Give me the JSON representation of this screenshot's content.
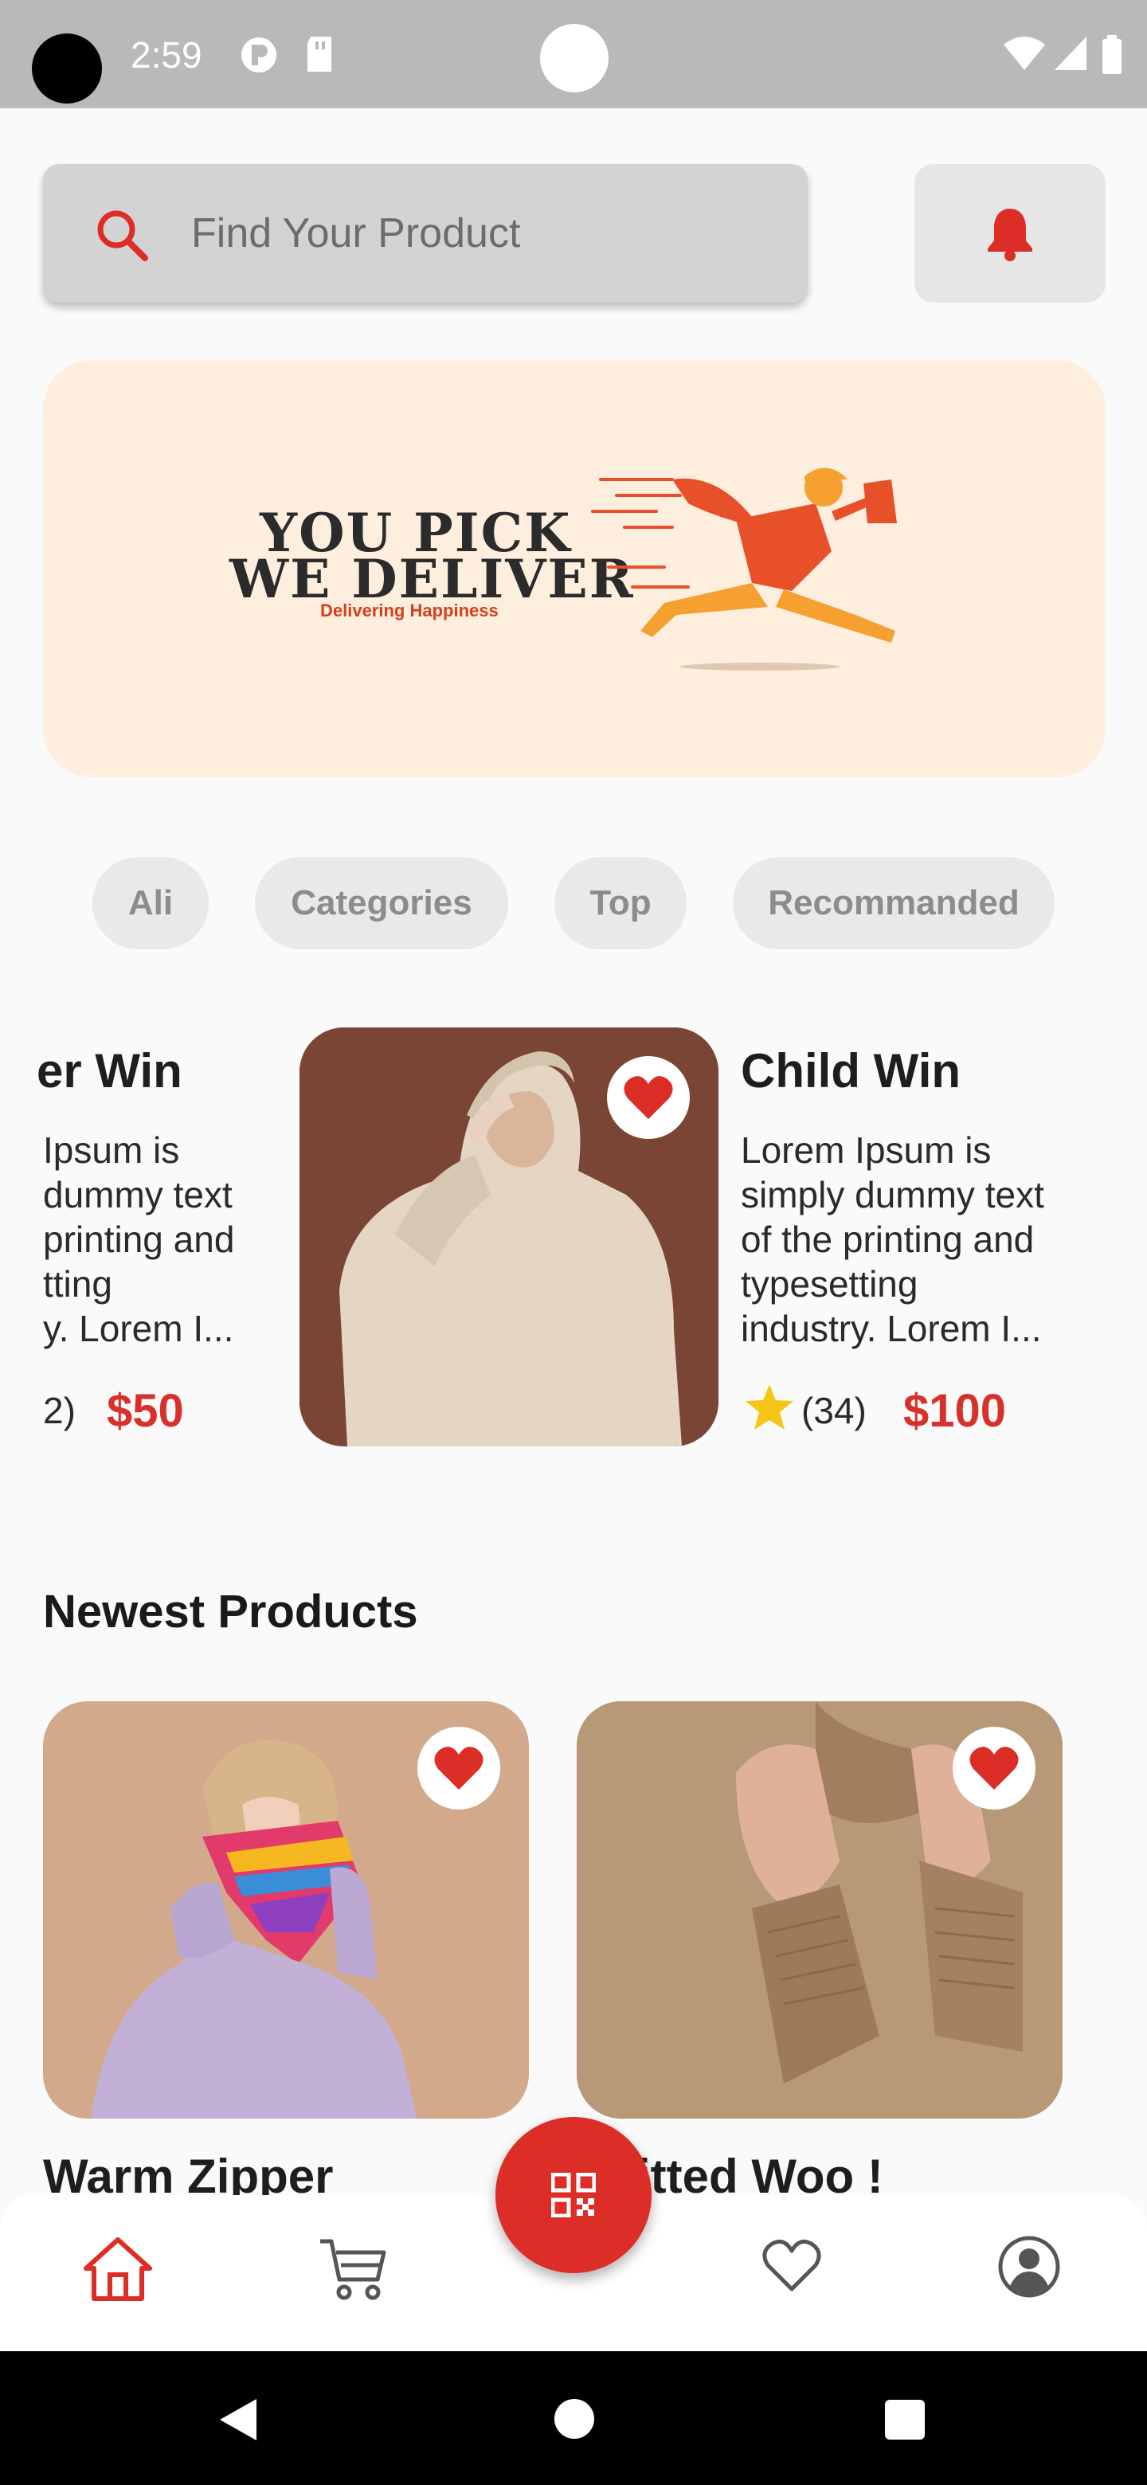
{
  "status_bar": {
    "time": "2:59"
  },
  "search": {
    "placeholder": "Find Your Product"
  },
  "banner": {
    "line1": "YOU PICK",
    "line2": "WE DELIVER",
    "tagline": "Delivering Happiness"
  },
  "tabs": [
    {
      "label": "Ali"
    },
    {
      "label": "Categories"
    },
    {
      "label": "Top"
    },
    {
      "label": "Recommanded"
    }
  ],
  "featured": [
    {
      "title": "er Win",
      "desc_lines": [
        "Ipsum is",
        "dummy text",
        "printing and",
        "tting",
        "y. Lorem I..."
      ],
      "rating": "2)",
      "price": "$50"
    },
    {
      "title": "Child Win",
      "desc_lines": [
        "Lorem Ipsum is",
        "simply dummy text",
        "of the printing and",
        "typesetting",
        "industry. Lorem I..."
      ],
      "rating": "(34)",
      "price": "$100"
    }
  ],
  "newest": {
    "section_title": "Newest Products",
    "products": [
      {
        "title": "Warm Zipper"
      },
      {
        "title": "itted Woo !"
      }
    ]
  },
  "colors": {
    "accent": "#dc2d26",
    "banner_bg": "#feeedd",
    "star": "#f5c518"
  },
  "icons": {
    "nav": [
      "home-icon",
      "cart-icon",
      "qr-code-icon",
      "heart-outline-icon",
      "profile-icon"
    ]
  }
}
